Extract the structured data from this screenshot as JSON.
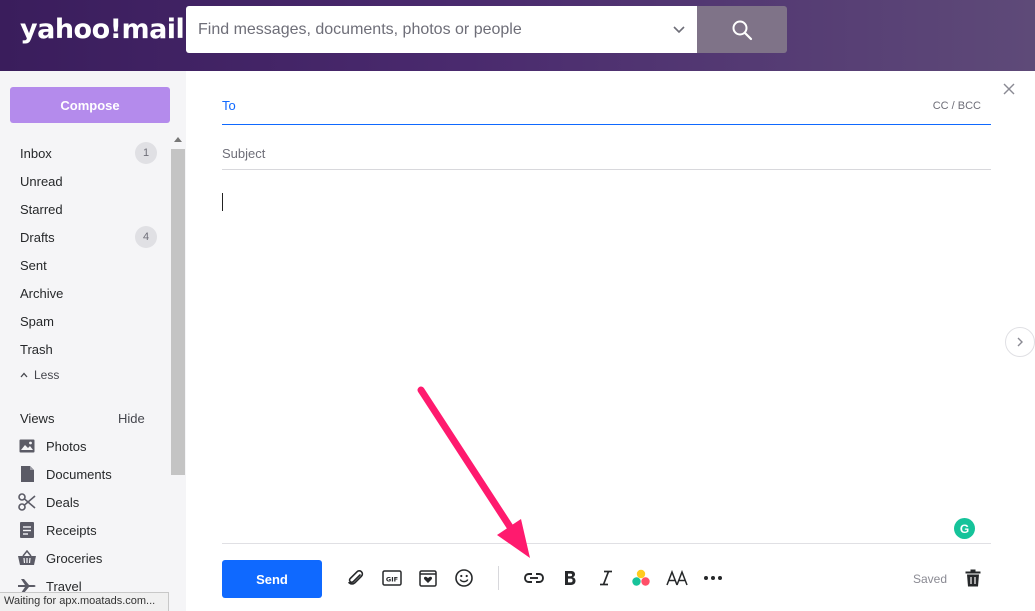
{
  "header": {
    "logo": "yahoo!mail",
    "search_placeholder": "Find messages, documents, photos or people"
  },
  "sidebar": {
    "compose_label": "Compose",
    "folders": [
      {
        "label": "Inbox",
        "badge": "1"
      },
      {
        "label": "Unread",
        "badge": ""
      },
      {
        "label": "Starred",
        "badge": ""
      },
      {
        "label": "Drafts",
        "badge": "4"
      },
      {
        "label": "Sent",
        "badge": ""
      },
      {
        "label": "Archive",
        "badge": ""
      },
      {
        "label": "Spam",
        "badge": ""
      },
      {
        "label": "Trash",
        "badge": ""
      }
    ],
    "less_label": "Less",
    "views_label": "Views",
    "hide_label": "Hide",
    "views": [
      {
        "label": "Photos",
        "icon": "photo-icon"
      },
      {
        "label": "Documents",
        "icon": "document-icon"
      },
      {
        "label": "Deals",
        "icon": "scissors-icon"
      },
      {
        "label": "Receipts",
        "icon": "receipt-icon"
      },
      {
        "label": "Groceries",
        "icon": "basket-icon"
      },
      {
        "label": "Travel",
        "icon": "plane-icon"
      }
    ]
  },
  "compose": {
    "to_label": "To",
    "cc_bcc_label": "CC / BCC",
    "subject_placeholder": "Subject",
    "grammarly_letter": "G",
    "send_label": "Send",
    "saved_label": "Saved",
    "toolbar_icons": [
      "attach-icon",
      "gif-icon",
      "sticker-icon",
      "emoji-icon",
      "link-icon",
      "bold-icon",
      "italic-icon",
      "color-icon",
      "font-size-icon",
      "more-icon",
      "trash-icon"
    ]
  },
  "status_bar": {
    "text": "Waiting for apx.moatads.com..."
  },
  "colors": {
    "header_start": "#3a1d5c",
    "compose_button": "#b48bec",
    "accent_blue": "#0f69ff",
    "annotation_arrow": "#ff1a6e",
    "grammarly": "#15c39a"
  }
}
